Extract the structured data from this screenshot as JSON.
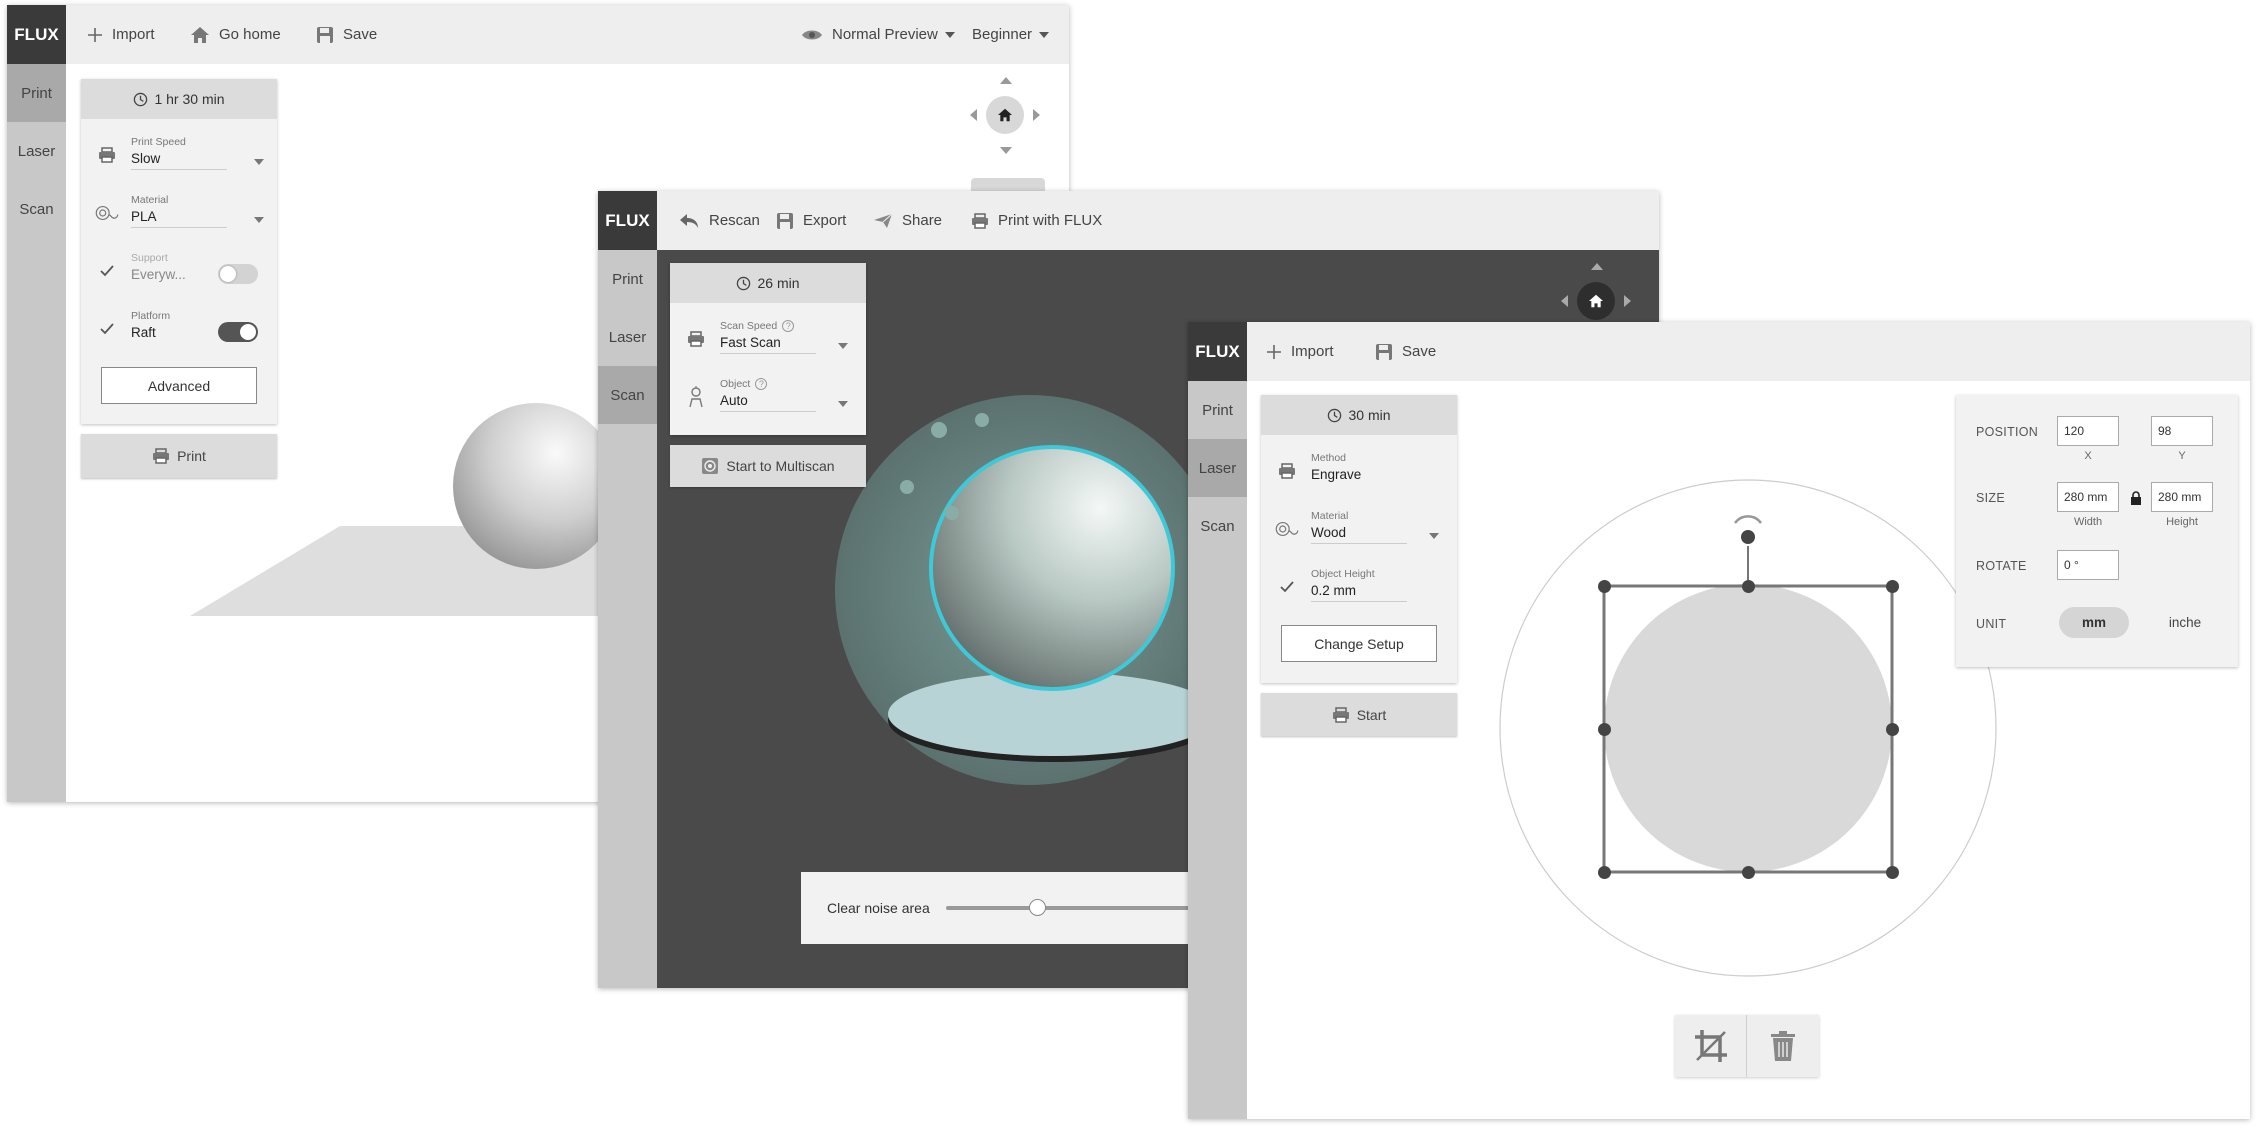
{
  "colors": {
    "accent_cyan": "#3fc8d8",
    "logo_bg": "#3a3a3a",
    "topbar_bg": "#eeeeee",
    "sidebar_bg": "#c8c8c8",
    "sidebar_active": "#a9a9a9",
    "viewport_dark": "#4a4a4a"
  },
  "print_window": {
    "logo": "FLUX",
    "toolbar": {
      "import": "Import",
      "go_home": "Go home",
      "save": "Save",
      "preview": "Normal Preview",
      "level": "Beginner"
    },
    "sidebar": [
      "Print",
      "Laser",
      "Scan"
    ],
    "panel": {
      "time": "1 hr 30 min",
      "print_speed_label": "Print Speed",
      "print_speed_value": "Slow",
      "material_label": "Material",
      "material_value": "PLA",
      "support_label": "Support",
      "support_value": "Everyw...",
      "support_on": false,
      "platform_label": "Platform",
      "platform_value": "Raft",
      "platform_on": true,
      "advanced": "Advanced"
    },
    "print_button": "Print",
    "icons": {
      "import": "plus-icon",
      "home": "home-icon",
      "save": "floppy-icon",
      "preview": "eye-icon",
      "speed": "printer-icon",
      "material": "filament-icon",
      "check": "check-icon",
      "clock": "clock-icon"
    }
  },
  "scan_window": {
    "logo": "FLUX",
    "toolbar": {
      "rescan": "Rescan",
      "export": "Export",
      "share": "Share",
      "print_with_flux": "Print with FLUX"
    },
    "sidebar": [
      "Print",
      "Laser",
      "Scan"
    ],
    "panel": {
      "time": "26 min",
      "scan_speed_label": "Scan Speed",
      "scan_speed_value": "Fast Scan",
      "object_label": "Object",
      "object_value": "Auto"
    },
    "multiscan_button": "Start to Multiscan",
    "noise_label": "Clear noise area",
    "noise_level": 0.33
  },
  "laser_window": {
    "logo": "FLUX",
    "toolbar": {
      "import": "Import",
      "save": "Save"
    },
    "sidebar": [
      "Print",
      "Laser",
      "Scan"
    ],
    "panel": {
      "time": "30 min",
      "method_label": "Method",
      "method_value": "Engrave",
      "material_label": "Material",
      "material_value": "Wood",
      "height_label": "Object Height",
      "height_value": "0.2 mm",
      "change_setup": "Change Setup"
    },
    "start_button": "Start",
    "props": {
      "position_label": "POSITION",
      "pos_x": "120",
      "pos_y": "98",
      "x_label": "X",
      "y_label": "Y",
      "size_label": "SIZE",
      "width": "280 mm",
      "height": "280 mm",
      "width_label": "Width",
      "height_label": "Height",
      "rotate_label": "ROTATE",
      "rotate": "0 °",
      "unit_label": "UNIT",
      "unit_mm": "mm",
      "unit_inch": "inche"
    }
  }
}
